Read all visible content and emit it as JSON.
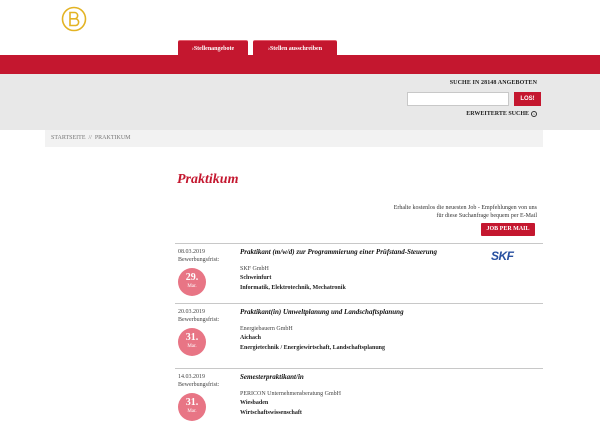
{
  "brand": {
    "accent": "#c4172f",
    "badge_color": "#e87585"
  },
  "nav": {
    "tabs": [
      {
        "label": "›Stellenangebote"
      },
      {
        "label": "›Stellen ausschreiben"
      }
    ]
  },
  "search": {
    "title": "SUCHE IN 28148 ANGEBOTEN",
    "input_value": "",
    "button_label": "LOS!",
    "advanced_label": "ERWEITERTE SUCHE"
  },
  "breadcrumb": {
    "home": "Startseite",
    "separator": "//",
    "current": "Praktikum"
  },
  "page": {
    "title": "Praktikum"
  },
  "mail_promo": {
    "text": "Erhalte kostenlos die neuesten Job - Empfehlungen von uns für diese Suchanfrage bequem per E-Mail",
    "button_label": "JOB PER MAIL"
  },
  "listings": [
    {
      "date": "08.03.2019",
      "deadline_label": "Bewerbungsfrist:",
      "deadline_day": "29.",
      "deadline_month": "Mar.",
      "title": "Praktikant (m/w/d) zur Programmierung einer Prüfstand-Steuerung",
      "company": "SKF GmbH",
      "city": "Schweinfurt",
      "field": "Informatik, Elektrotechnik, Mechatronik",
      "logo_text": "SKF"
    },
    {
      "date": "20.03.2019",
      "deadline_label": "Bewerbungsfrist:",
      "deadline_day": "31.",
      "deadline_month": "Mar.",
      "title": "Praktikant(in) Umweltplanung und Landschaftsplanung",
      "company": "Energiebauern GmbH",
      "city": "Aichach",
      "field": "Energietechnik / Energiewirtschaft, Landschaftsplanung"
    },
    {
      "date": "14.03.2019",
      "deadline_label": "Bewerbungsfrist:",
      "deadline_day": "31.",
      "deadline_month": "Mar.",
      "title": "Semesterpraktikant/in",
      "company": "PERICON Unternehmensberatung GmbH",
      "city": "Wiesbaden",
      "field": "Wirtschaftswissenschaft"
    }
  ]
}
